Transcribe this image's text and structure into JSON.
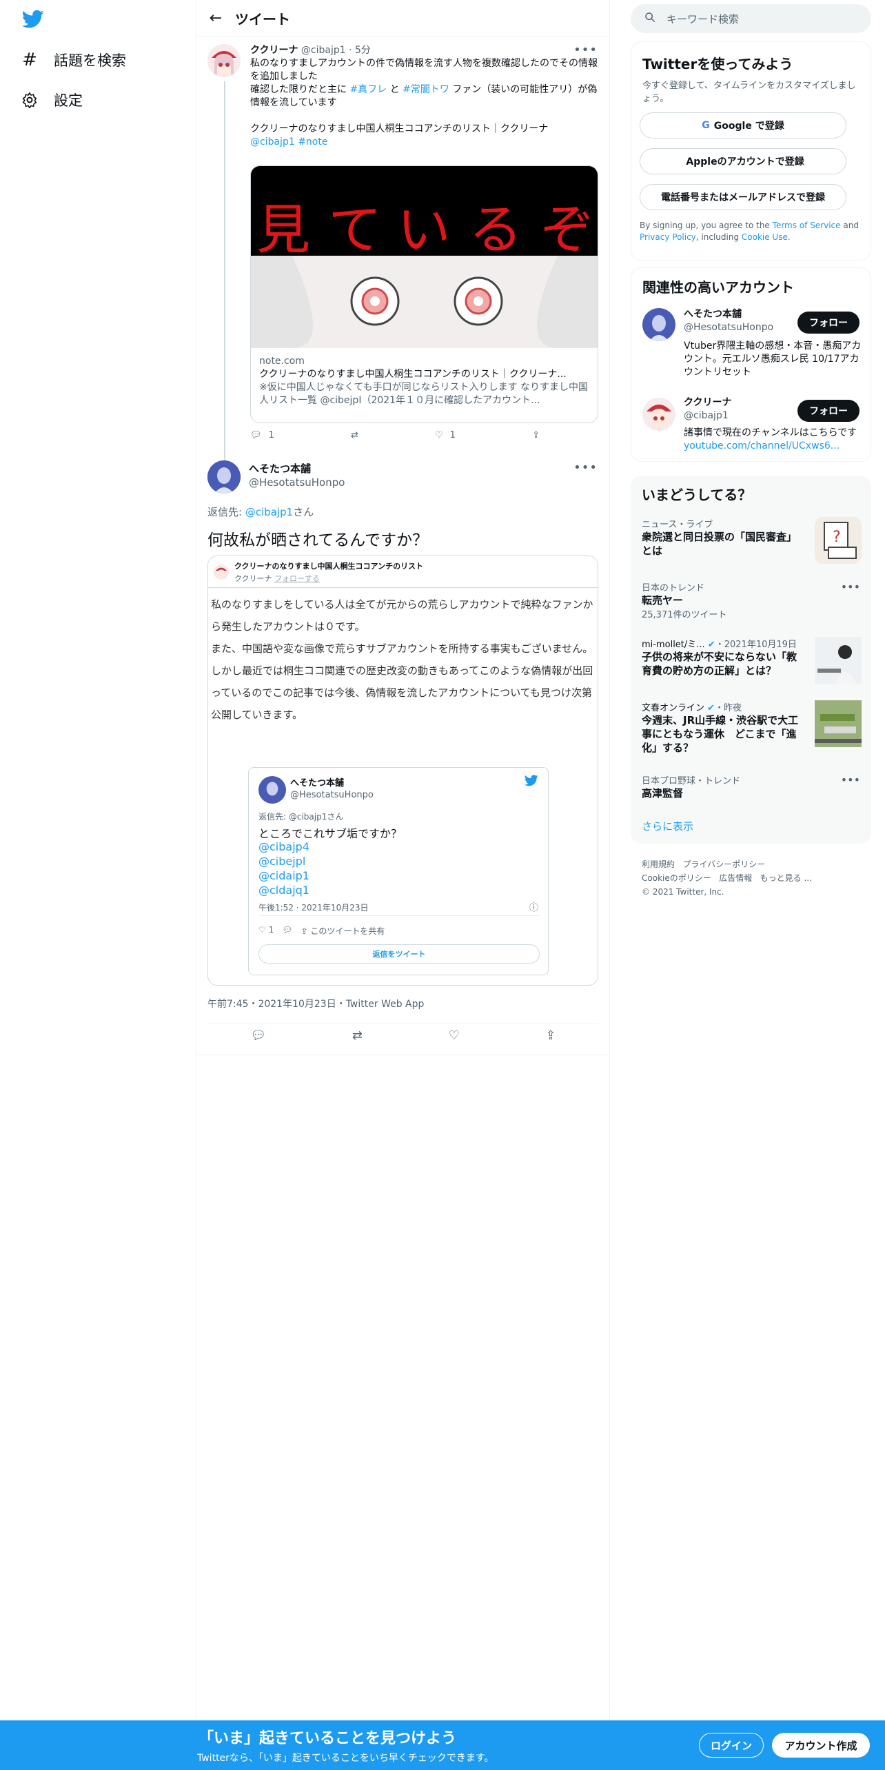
{
  "nav": {
    "logo": "twitter-logo",
    "items": [
      {
        "icon": "hashtag-icon",
        "label": "話題を検索"
      },
      {
        "icon": "gear-icon",
        "label": "設定"
      }
    ]
  },
  "header": {
    "back_icon": "arrow-left-icon",
    "title": "ツイート"
  },
  "tweet1": {
    "name": "ククリーナ",
    "handle": "@cibajp1",
    "time": "5分",
    "line1": "私のなりすましアカウントの件で偽情報を流す人物を複数確認したのでその情報を追加しました",
    "line2_pre": "確認した限りだと主に",
    "tag1": "#真フレ",
    "line2_mid": "と",
    "tag2": "#常闇トワ",
    "line2_post": "ファン（装いの可能性アリ）が偽情報を流しています",
    "line3": "ククリーナのなりすまし中国人桐生ココアンチのリスト｜ククリーナ",
    "mention": "@cibajp1",
    "hashtag_note": "#note",
    "card": {
      "banner": [
        "見",
        "て",
        "い",
        "る",
        "ぞ"
      ],
      "domain": "note.com",
      "title": "ククリーナのなりすまし中国人桐生ココアンチのリスト｜ククリーナ...",
      "desc": "※仮に中国人じゃなくても手口が同じならリスト入りします なりすまし中国人リスト一覧 @cibejpI（2021年１０月に確認したアカウント..."
    },
    "reply_count": "1",
    "like_count": "1"
  },
  "tweet2": {
    "name": "へそたつ本舗",
    "handle": "@HesotatsuHonpo",
    "reply_to_label": "返信先:",
    "reply_to": "@cibajp1",
    "reply_to_suffix": "さん",
    "text": "何故私が晒されてるんですか？",
    "quote": {
      "title": "ククリーナのなりすまし中国人桐生ココアンチのリスト",
      "author": "ククリーナ",
      "follow": "フォローする",
      "paragraph1": "私のなりすましをしている人は全てが元からの荒らしアカウントで純粋なファンから発生したアカウントは０です。",
      "paragraph2": "また、中国語や変な画像で荒らすサブアカウントを所持する事実もございません。",
      "paragraph3": "しかし最近では桐生ココ関連での歴史改変の動きもあってこのような偽情報が出回っているのでこの記事では今後、偽情報を流したアカウントについても見つけ次第公開していきます。",
      "embed": {
        "name": "へそたつ本舗",
        "handle": "@HesotatsuHonpo",
        "reply_to": "返信先: @cibajp1さん",
        "text": "ところでこれサブ垢ですか？",
        "links": [
          "@cibajp4",
          "@cibejpl",
          "@cidaip1",
          "@cldajq1"
        ],
        "time": "午後1:52 · 2021年10月23日",
        "like_count": "1",
        "share": "このツイートを共有",
        "reply_button": "返信をツイート"
      }
    },
    "timestamp": "午前7:45・2021年10月23日・Twitter Web App"
  },
  "right": {
    "search_placeholder": "キーワード検索",
    "signup": {
      "title": "Twitterを使ってみよう",
      "desc": "今すぐ登録して、タイムラインをカスタマイズしましょう。",
      "google": "Google で登録",
      "apple": "Appleのアカウントで登録",
      "phone": "電話番号またはメールアドレスで登録",
      "terms_pre": "By signing up, you agree to the",
      "terms": "Terms of Service",
      "terms_and": "and",
      "privacy": "Privacy Policy",
      "terms_inc": ", including",
      "cookie": "Cookie Use."
    },
    "related": {
      "title": "関連性の高いアカウント",
      "follow": "フォロー",
      "accounts": [
        {
          "name": "へそたつ本舗",
          "handle": "@HesotatsuHonpo",
          "bio": "Vtuber界隈主軸の感想・本音・愚痴アカウント。元エルソ愚痴スレ民 10/17アカウントリセット"
        },
        {
          "name": "ククリーナ",
          "handle": "@cibajp1",
          "bio": "諸事情で現在のチャンネルはこちらです",
          "bio_link": "youtube.com/channel/UCxws6..."
        }
      ]
    },
    "trends": {
      "title": "いまどうしてる？",
      "items": [
        {
          "cat": "ニュース・ライブ",
          "title": "衆院選と同日投票の「国民審査」とは"
        },
        {
          "cat": "日本のトレンド",
          "title": "転売ヤー",
          "count": "25,371件のツイート"
        },
        {
          "cat": "mi-mollet/ミ...",
          "cat_suffix": "・2021年10月19日",
          "title": "子供の将来が不安にならない「教育費の貯め方の正解」とは？"
        },
        {
          "cat": "文春オンライン",
          "cat_suffix": "・昨夜",
          "title": "今週末、JR山手線・渋谷駅で大工事にともなう運休　どこまで「進化」する？"
        },
        {
          "cat": "日本プロ野球・トレンド",
          "title": "高津監督"
        }
      ],
      "more": "さらに表示"
    },
    "footer": {
      "line1": [
        "利用規約",
        "プライバシーポリシー"
      ],
      "line2": [
        "Cookieのポリシー",
        "広告情報",
        "もっと見る ..."
      ],
      "copyright": "© 2021 Twitter, Inc."
    }
  },
  "bottombar": {
    "headline": "「いま」起きていることを見つけよう",
    "sub": "Twitterなら、「いま」起きていることをいち早くチェックできます。",
    "login": "ログイン",
    "signup": "アカウント作成"
  }
}
